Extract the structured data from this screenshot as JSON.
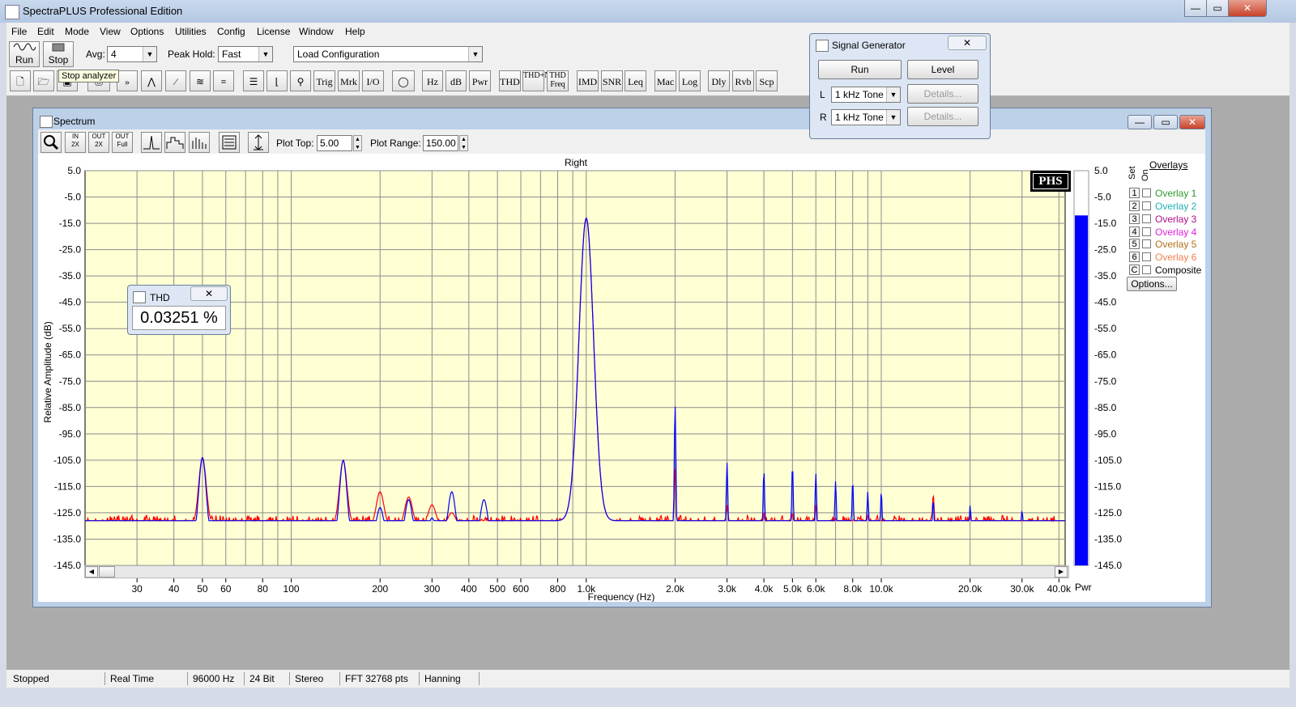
{
  "app": {
    "title": "SpectraPLUS Professional Edition"
  },
  "menu": [
    "File",
    "Edit",
    "Mode",
    "View",
    "Options",
    "Utilities",
    "Config",
    "License",
    "Window",
    "Help"
  ],
  "toolbar1": {
    "run_label": "Run",
    "stop_label": "Stop",
    "avg_label": "Avg:",
    "avg_value": "4",
    "peak_hold_label": "Peak Hold:",
    "peak_hold_value": "Fast",
    "config_value": "Load Configuration"
  },
  "toolbar2": {
    "buttons": [
      "Trig",
      "Mrk",
      "I/O",
      "Hz",
      "dB",
      "Pwr",
      "THD",
      "THD+N",
      "THD Freq",
      "IMD",
      "SNR",
      "Leq",
      "Mac",
      "Log",
      "Dly",
      "Rvb",
      "Scp"
    ]
  },
  "tooltip": "Stop analyzer",
  "spectrum_window": {
    "title": "Spectrum",
    "plot_top_label": "Plot Top:",
    "plot_top_value": "5.00",
    "plot_range_label": "Plot Range:",
    "plot_range_value": "150.00",
    "channel_label": "Right",
    "logo": "PHS",
    "pwr_label": "Pwr",
    "overlays_title": "Overlays",
    "set_label": "Set",
    "on_label": "On",
    "options_label": "Options...",
    "overlays": [
      {
        "set": "1",
        "label": "Overlay 1",
        "color": "#2e9a2e"
      },
      {
        "set": "2",
        "label": "Overlay 2",
        "color": "#20b3b3"
      },
      {
        "set": "3",
        "label": "Overlay 3",
        "color": "#b0108a"
      },
      {
        "set": "4",
        "label": "Overlay 4",
        "color": "#e020e0"
      },
      {
        "set": "5",
        "label": "Overlay 5",
        "color": "#b0701a"
      },
      {
        "set": "6",
        "label": "Overlay 6",
        "color": "#f08050"
      },
      {
        "set": "C",
        "label": "Composite",
        "color": "#000000"
      }
    ]
  },
  "thd_window": {
    "title": "THD",
    "value": "0.03251 %"
  },
  "signal_generator": {
    "title": "Signal Generator",
    "run_label": "Run",
    "level_label": "Level",
    "left_label": "L",
    "right_label": "R",
    "left_tone": "1 kHz Tone",
    "right_tone": "1 kHz Tone",
    "details_label": "Details..."
  },
  "status": [
    "Stopped",
    "Real Time",
    "96000 Hz",
    "24 Bit",
    "Stereo",
    "FFT 32768 pts",
    "Hanning"
  ],
  "chart_data": {
    "type": "line",
    "title": "Right",
    "xlabel": "Frequency (Hz)",
    "ylabel": "Relative Amplitude (dB)",
    "x_scale": "log",
    "xlim": [
      20,
      42000
    ],
    "ylim": [
      -145,
      5
    ],
    "grid": true,
    "x_tick_values": [
      30,
      40,
      50,
      60,
      80,
      100,
      200,
      300,
      400,
      500,
      600,
      800,
      1000,
      2000,
      3000,
      4000,
      5000,
      6000,
      8000,
      10000,
      20000,
      30000,
      40000
    ],
    "x_tick_labels": [
      "30",
      "40",
      "50",
      "60",
      "80",
      "100",
      "200",
      "300",
      "400",
      "500",
      "600",
      "800",
      "1.0k",
      "2.0k",
      "3.0k",
      "4.0k",
      "5.0k",
      "6.0k",
      "8.0k",
      "10.0k",
      "20.0k",
      "30.0k",
      "40.0k"
    ],
    "y_ticks": [
      5,
      -5,
      -15,
      -25,
      -35,
      -45,
      -55,
      -65,
      -75,
      -85,
      -95,
      -105,
      -115,
      -125,
      -135,
      -145
    ],
    "y_tick_labels": [
      "5.0",
      "-5.0",
      "-15.0",
      "-25.0",
      "-35.0",
      "-45.0",
      "-55.0",
      "-65.0",
      "-75.0",
      "-85.0",
      "-95.0",
      "-105.0",
      "-115.0",
      "-125.0",
      "-135.0",
      "-145.0"
    ],
    "pwr_level_db": -12,
    "series": [
      {
        "color": "#ff0000",
        "peaks": [
          [
            50,
            -104
          ],
          [
            150,
            -105
          ],
          [
            200,
            -117
          ],
          [
            250,
            -119
          ],
          [
            300,
            -122
          ],
          [
            350,
            -125
          ],
          [
            1000,
            -13
          ],
          [
            2000,
            -108
          ],
          [
            3000,
            -122
          ],
          [
            4000,
            -125
          ],
          [
            5000,
            -125
          ],
          [
            6000,
            -122
          ],
          [
            7000,
            -127
          ],
          [
            9000,
            -126
          ],
          [
            15000,
            -118
          ],
          [
            20000,
            -126
          ],
          [
            30000,
            -128
          ]
        ],
        "floor_db": -130
      },
      {
        "color": "#0000ff",
        "peaks": [
          [
            50,
            -104
          ],
          [
            150,
            -105
          ],
          [
            200,
            -123
          ],
          [
            250,
            -120
          ],
          [
            300,
            -127
          ],
          [
            350,
            -117
          ],
          [
            450,
            -120
          ],
          [
            1000,
            -13
          ],
          [
            2000,
            -84
          ],
          [
            3000,
            -106
          ],
          [
            4000,
            -109
          ],
          [
            5000,
            -107
          ],
          [
            6000,
            -110
          ],
          [
            7000,
            -113
          ],
          [
            8000,
            -113
          ],
          [
            9000,
            -117
          ],
          [
            10000,
            -117
          ],
          [
            15000,
            -120
          ],
          [
            20000,
            -122
          ],
          [
            30000,
            -124
          ]
        ],
        "floor_db": -136
      }
    ]
  }
}
